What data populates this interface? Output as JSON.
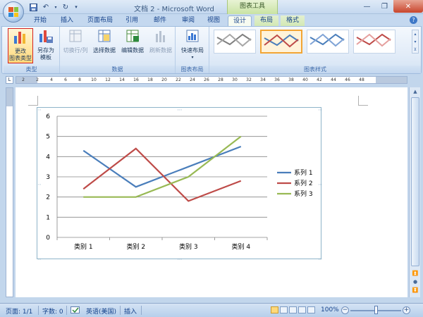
{
  "app": {
    "title": "文档 2 - Microsoft Word",
    "context_title": "图表工具"
  },
  "tabs": [
    {
      "label": "开始"
    },
    {
      "label": "插入"
    },
    {
      "label": "页面布局"
    },
    {
      "label": "引用"
    },
    {
      "label": "邮件"
    },
    {
      "label": "审阅"
    },
    {
      "label": "视图"
    },
    {
      "label": "设计",
      "active": true
    },
    {
      "label": "布局"
    },
    {
      "label": "格式"
    }
  ],
  "ribbon": {
    "groups": {
      "type": {
        "label": "类型",
        "change_type": "更改\n图表类型",
        "save_template": "另存为\n模板"
      },
      "data": {
        "label": "数据",
        "switch_rowcol": "切换行/列",
        "select_data": "选择数据",
        "edit_data": "编辑数据",
        "refresh_data": "刷新数据"
      },
      "layout": {
        "label": "图表布局",
        "quick_layout": "快速布局"
      },
      "styles": {
        "label": "图表样式"
      }
    }
  },
  "ruler": {
    "numbers": [
      "2",
      "2",
      "4",
      "6",
      "8",
      "10",
      "12",
      "14",
      "16",
      "18",
      "20",
      "22",
      "24",
      "26",
      "28",
      "30",
      "32",
      "34",
      "36",
      "38",
      "40",
      "42",
      "44",
      "46",
      "48"
    ]
  },
  "chart_data": {
    "type": "line",
    "categories": [
      "类别 1",
      "类别 2",
      "类别 3",
      "类别 4"
    ],
    "series": [
      {
        "name": "系列 1",
        "values": [
          4.3,
          2.5,
          3.5,
          4.5
        ],
        "color": "#4a7ebb"
      },
      {
        "name": "系列 2",
        "values": [
          2.4,
          4.4,
          1.8,
          2.8
        ],
        "color": "#be4b48"
      },
      {
        "name": "系列 3",
        "values": [
          2.0,
          2.0,
          3.0,
          5.0
        ],
        "color": "#98b954"
      }
    ],
    "ylim": [
      0,
      6
    ],
    "yticks": [
      "0",
      "1",
      "2",
      "3",
      "4",
      "5",
      "6"
    ],
    "grid": true,
    "legend": "right"
  },
  "status": {
    "page": "页面: 1/1",
    "words": "字数: 0",
    "language": "英语(美国)",
    "mode": "插入",
    "zoom": "100%"
  }
}
